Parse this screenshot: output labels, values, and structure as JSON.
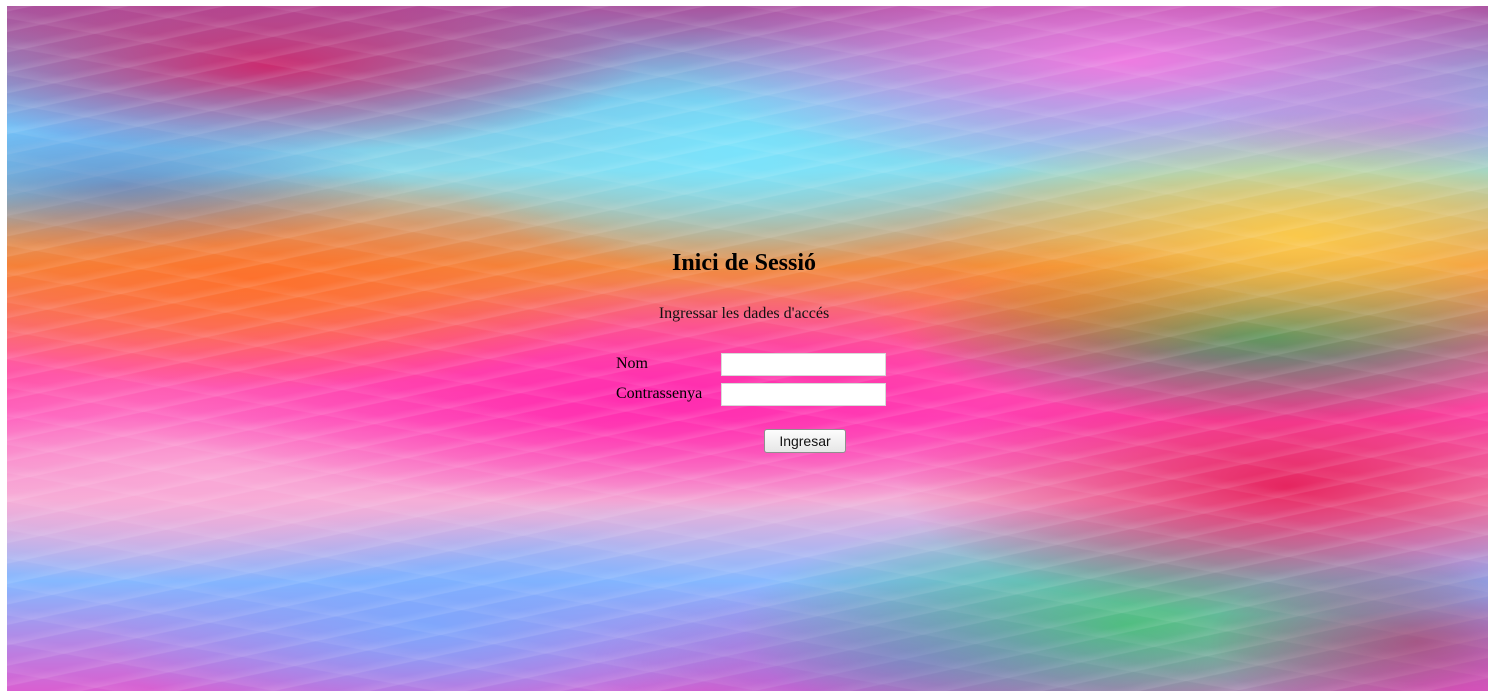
{
  "page": {
    "title": "Inici de Sessió",
    "subtitle": "Ingressar les dades d'accés"
  },
  "form": {
    "name_label": "Nom",
    "name_value": "",
    "password_label": "Contrassenya",
    "password_value": "",
    "submit_label": "Ingresar"
  },
  "theme": {
    "background_style": "vivid multicolor swirl",
    "accent_colors": [
      "#ff4eb7",
      "#79bfe6",
      "#f18a3f",
      "#2f9d63",
      "#d6195f"
    ]
  }
}
